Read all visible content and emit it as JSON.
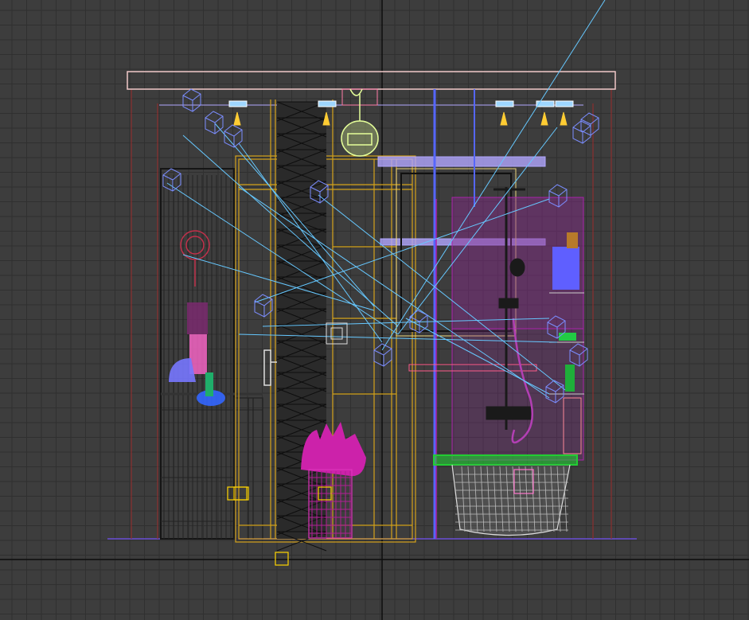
{
  "viewport": {
    "view": "front wireframe",
    "grid": true,
    "world_axes": true
  },
  "colors": {
    "background": "#3d3d3d",
    "grid_line": "#303030",
    "world_axis": "#0d0d0d",
    "ceiling_frame": "#f2c9c9",
    "wall_edges": "#8b2e2e",
    "door_frame": "#d4a21a",
    "tile_column": "#111111",
    "glass_panel": "#b1a6ff",
    "light_cone": "#66c8ff",
    "lamp_fixture": "#e5ff99",
    "plant": "#cc22aa",
    "bathtub": "#22cc33",
    "shower_pipe": "#1a1a1a",
    "wall_panel": "#aa22aa",
    "bottles": "#6666ff",
    "dimension_marker": "#ffd400"
  },
  "scene_objects": [
    {
      "name": "ceiling-beam"
    },
    {
      "name": "left-shelving-unit"
    },
    {
      "name": "vanity-cabinet"
    },
    {
      "name": "tile-column"
    },
    {
      "name": "sliding-door-frame"
    },
    {
      "name": "pendant-lamp"
    },
    {
      "name": "potted-plant"
    },
    {
      "name": "shower-enclosure"
    },
    {
      "name": "shower-mixer"
    },
    {
      "name": "bathtub"
    },
    {
      "name": "toiletry-shelf"
    },
    {
      "name": "spotlight-fixtures"
    },
    {
      "name": "light-targets"
    }
  ]
}
